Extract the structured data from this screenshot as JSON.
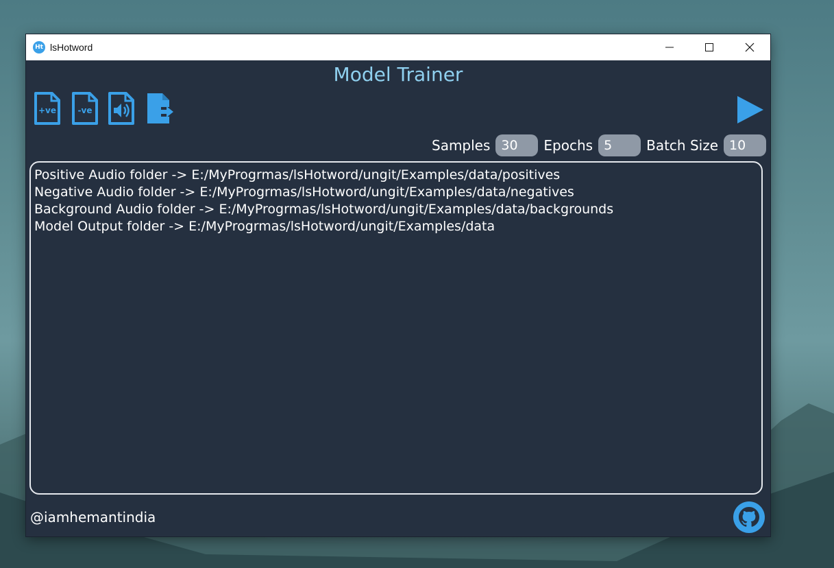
{
  "window": {
    "title": "lsHotword",
    "icon_text": "Ht",
    "controls": [
      "minimize-icon",
      "maximize-icon",
      "close-icon"
    ]
  },
  "header": {
    "title": "Model Trainer"
  },
  "toolbar": {
    "buttons": [
      {
        "icon": "positive-file-icon",
        "text": "+ve"
      },
      {
        "icon": "negative-file-icon",
        "text": "-ve"
      },
      {
        "icon": "audio-file-icon"
      },
      {
        "icon": "export-file-icon"
      }
    ],
    "run_icon": "play-icon"
  },
  "params": {
    "samples_label": "Samples",
    "samples_value": "30",
    "epochs_label": "Epochs",
    "epochs_value": "5",
    "batch_label": "Batch Size",
    "batch_value": "10"
  },
  "log": {
    "lines": [
      "Positive Audio folder -> E:/MyProgrmas/lsHotword/ungit/Examples/data/positives",
      "Negative Audio folder -> E:/MyProgrmas/lsHotword/ungit/Examples/data/negatives",
      "Background Audio folder -> E:/MyProgrmas/lsHotword/ungit/Examples/data/backgrounds",
      "Model Output folder -> E:/MyProgrmas/lsHotword/ungit/Examples/data"
    ]
  },
  "footer": {
    "handle": "@iamhemantindia",
    "github_icon": "github-icon"
  },
  "colors": {
    "app_background": "#253040",
    "accent": "#3aa0e8",
    "title": "#8fd0ef",
    "input_bg": "#8f99a6"
  }
}
